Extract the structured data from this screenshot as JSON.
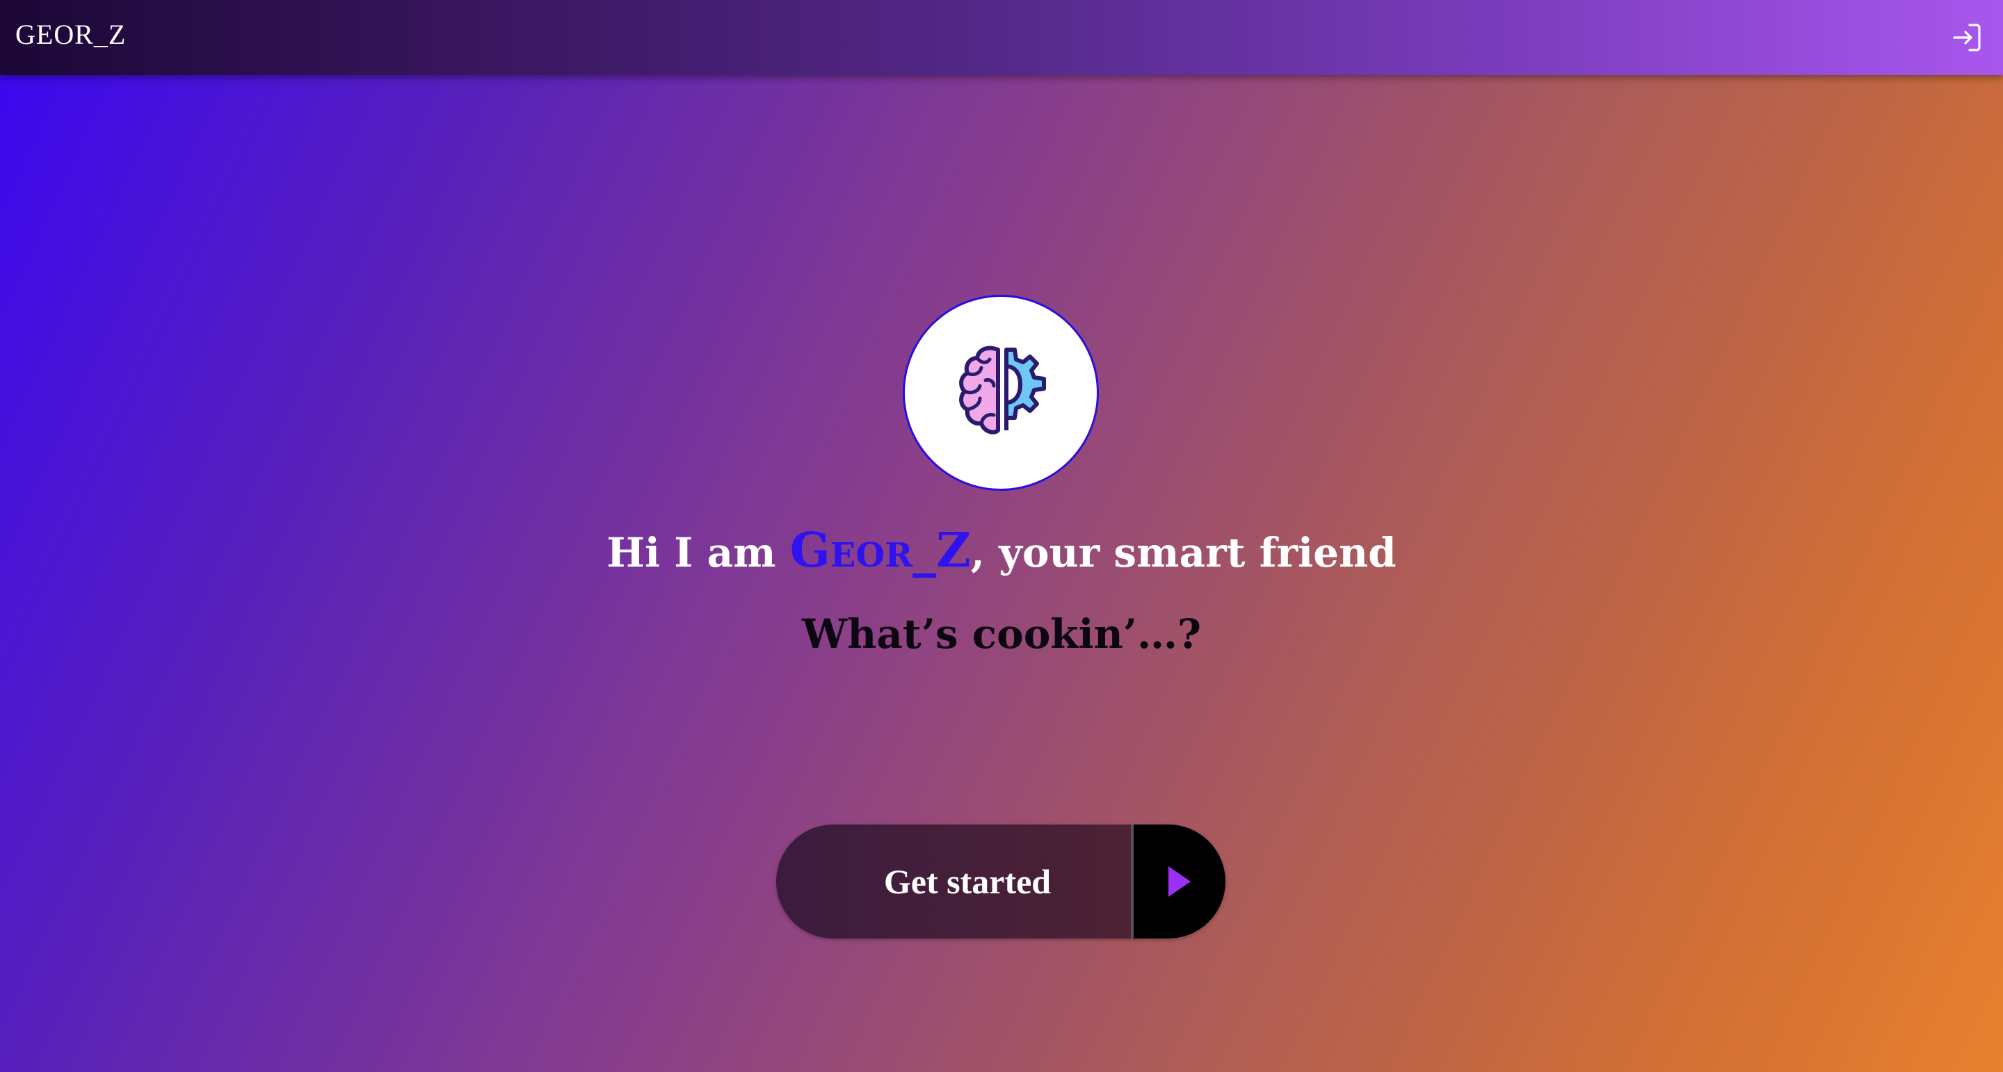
{
  "header": {
    "brand": "GEOR_Z",
    "login_icon": "login-arrow-icon"
  },
  "hero": {
    "logo_icon": "brain-gear-icon",
    "headline_prefix": "Hi I am ",
    "headline_name": "Geor_Z",
    "headline_suffix": ", your smart friend",
    "subline": "What’s cookin’…?"
  },
  "cta": {
    "label": "Get started",
    "arrow_icon": "play-arrow-icon"
  },
  "colors": {
    "accent_name": "#2f12f0",
    "arrow": "#9b30f5",
    "brain": "#f0a8e8",
    "gear": "#6ec8f5",
    "outline": "#2b1a6e"
  }
}
